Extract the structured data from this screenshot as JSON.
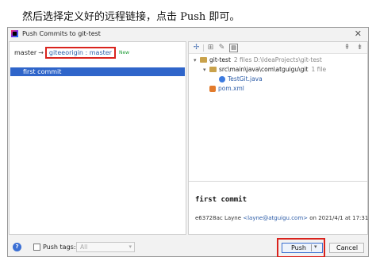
{
  "caption": "然后选择定义好的远程链接，点击 Push 即可。",
  "dialog": {
    "title": "Push Commits to git-test"
  },
  "left": {
    "local_branch": "master",
    "arrow": "→",
    "remote_branch": "giteeorigin : master",
    "new_badge": "New",
    "commits": [
      "first commit"
    ]
  },
  "toolbar": {
    "icons": [
      "pin-icon",
      "expand-icon",
      "edit-icon",
      "preview-icon",
      "expand-all-icon",
      "collapse-all-icon"
    ]
  },
  "tree": {
    "root": {
      "name": "git-test",
      "meta": "2 files  D:\\IdeaProjects\\git-test"
    },
    "folder": {
      "name": "src\\main\\java\\com\\atguigu\\git",
      "meta": "1 file"
    },
    "java_file": "TestGit.java",
    "xml_file": "pom.xml"
  },
  "detail": {
    "message": "first commit",
    "hash_author": "e63728ac Layne",
    "email": "<layne@atguigu.com>",
    "date": "on 2021/4/1 at 17:31"
  },
  "footer": {
    "help": "?",
    "push_tags_label": "Push tags:",
    "push_tags_value": "All",
    "push_label": "Push",
    "cancel_label": "Cancel"
  },
  "colors": {
    "selection": "#2f65ca",
    "highlight": "#d9231d",
    "link": "#2d5da8",
    "new_badge": "#1f9e37"
  }
}
